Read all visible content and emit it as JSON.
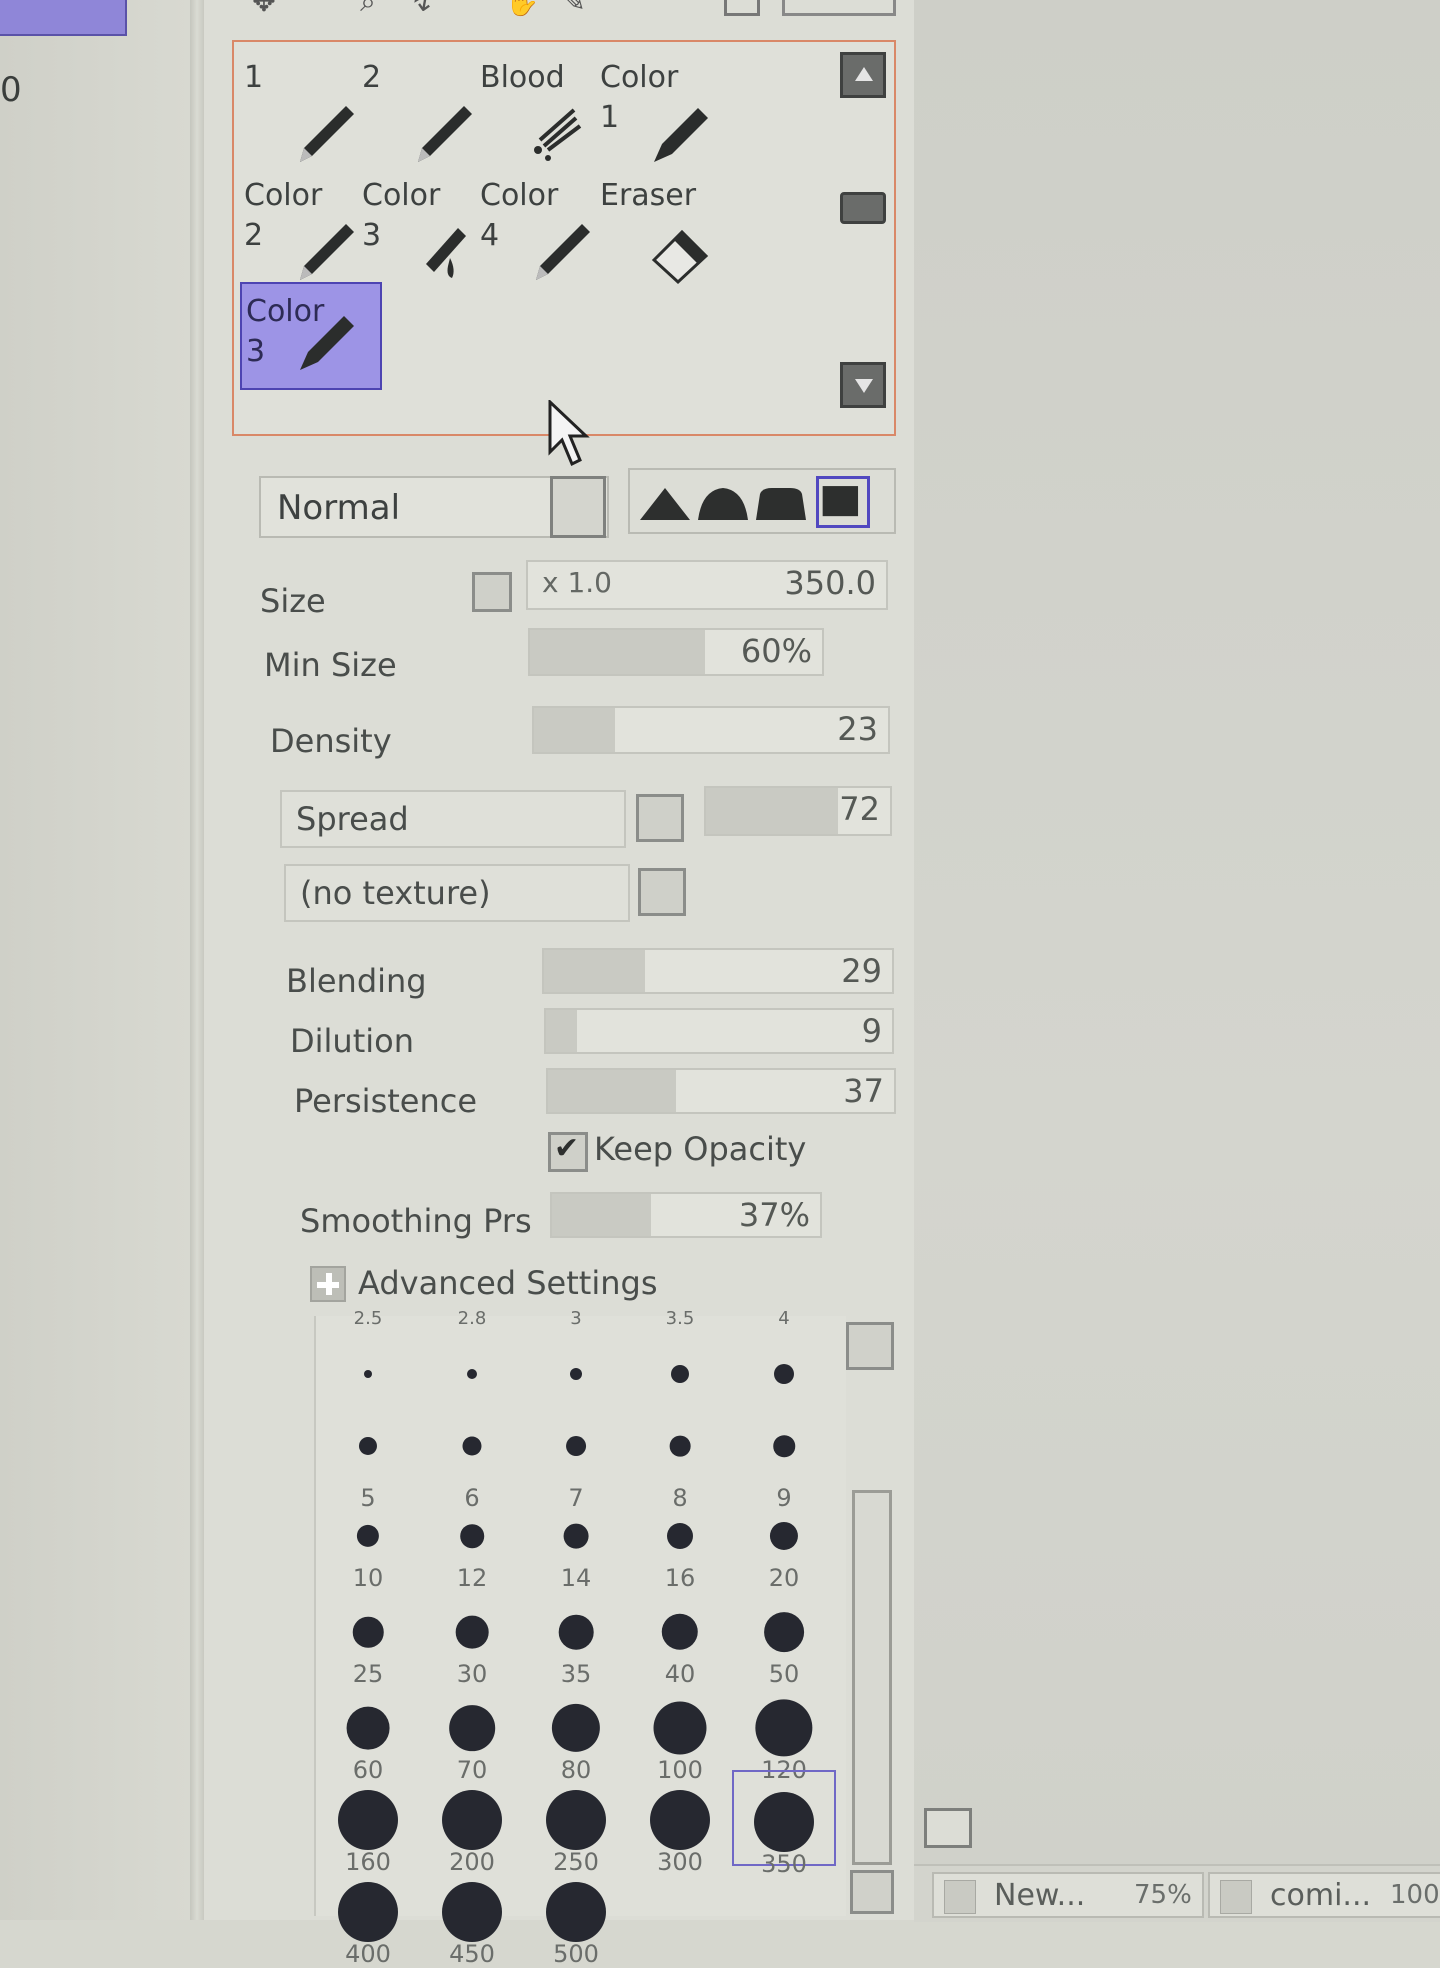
{
  "left_panel": {
    "value": "0"
  },
  "brushes": [
    {
      "label": "1",
      "icon": "pencil-icon",
      "selected": false
    },
    {
      "label": "2",
      "icon": "pencil-icon",
      "selected": false
    },
    {
      "label": "Blood",
      "icon": "splatter-brush-icon",
      "selected": false
    },
    {
      "label": "Color\n1",
      "icon": "marker-icon",
      "selected": false
    },
    {
      "label": "Color\n2",
      "icon": "pencil-icon",
      "selected": false
    },
    {
      "label": "Color\n3",
      "icon": "watercolor-brush-icon",
      "selected": false
    },
    {
      "label": "Color\n4",
      "icon": "pencil-icon",
      "selected": false
    },
    {
      "label": "Eraser",
      "icon": "eraser-icon",
      "selected": false
    },
    {
      "label": "Color\n3",
      "icon": "marker-icon",
      "selected": true
    }
  ],
  "blend": {
    "mode": "Normal"
  },
  "params": {
    "size": {
      "label": "Size",
      "multiplier": "x 1.0",
      "value": "350.0"
    },
    "min_size": {
      "label": "Min Size",
      "value": "60%",
      "level": 0.6
    },
    "density": {
      "label": "Density",
      "value": "23",
      "level": 0.23
    },
    "spread": {
      "label": "Spread",
      "value": "72",
      "level": 0.72
    },
    "texture": {
      "label": "(no texture)"
    },
    "blending": {
      "label": "Blending",
      "value": "29",
      "level": 0.29
    },
    "dilution": {
      "label": "Dilution",
      "value": "9",
      "level": 0.09
    },
    "persistence": {
      "label": "Persistence",
      "value": "37",
      "level": 0.37
    },
    "keep_opacity": {
      "label": "Keep Opacity",
      "checked": true
    },
    "smoothing": {
      "label": "Smoothing Prs",
      "value": "37%",
      "level": 0.37
    },
    "advanced": {
      "label": "Advanced Settings"
    }
  },
  "size_presets": {
    "top_row_partial": [
      "2.5",
      "2.8",
      "3",
      "3.5",
      "4"
    ],
    "sizes": [
      "5",
      "6",
      "7",
      "8",
      "9",
      "10",
      "12",
      "14",
      "16",
      "20",
      "25",
      "30",
      "35",
      "40",
      "50",
      "60",
      "70",
      "80",
      "100",
      "120",
      "160",
      "200",
      "250",
      "300",
      "350",
      "400",
      "450",
      "500"
    ],
    "selected": "350"
  },
  "documents": [
    {
      "name": "New...",
      "zoom": "75%"
    },
    {
      "name": "comi...",
      "zoom": "100"
    }
  ]
}
